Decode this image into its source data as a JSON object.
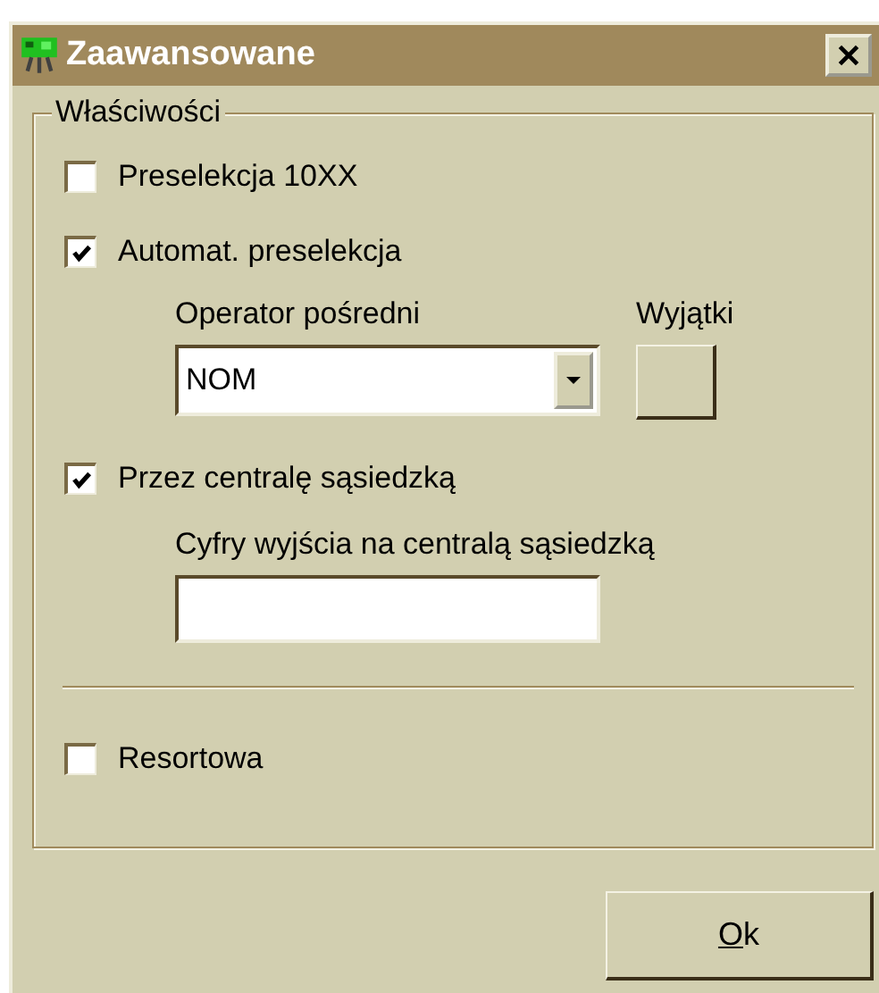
{
  "window": {
    "title": "Zaawansowane"
  },
  "group": {
    "label": "Właściwości",
    "preselection": {
      "label": "Preselekcja 10XX",
      "checked": false
    },
    "auto_preselection": {
      "label": "Automat. preselekcja",
      "checked": true
    },
    "operator": {
      "label": "Operator pośredni",
      "value": "NOM"
    },
    "exceptions": {
      "label": "Wyjątki"
    },
    "neighbor": {
      "label": "Przez centralę sąsiedzką",
      "checked": true
    },
    "exit_digits": {
      "label": "Cyfry wyjścia na centralą sąsiedzką"
    },
    "departmental": {
      "label": "Resortowa",
      "checked": false
    }
  },
  "buttons": [
    {
      "label": "Ok"
    }
  ]
}
